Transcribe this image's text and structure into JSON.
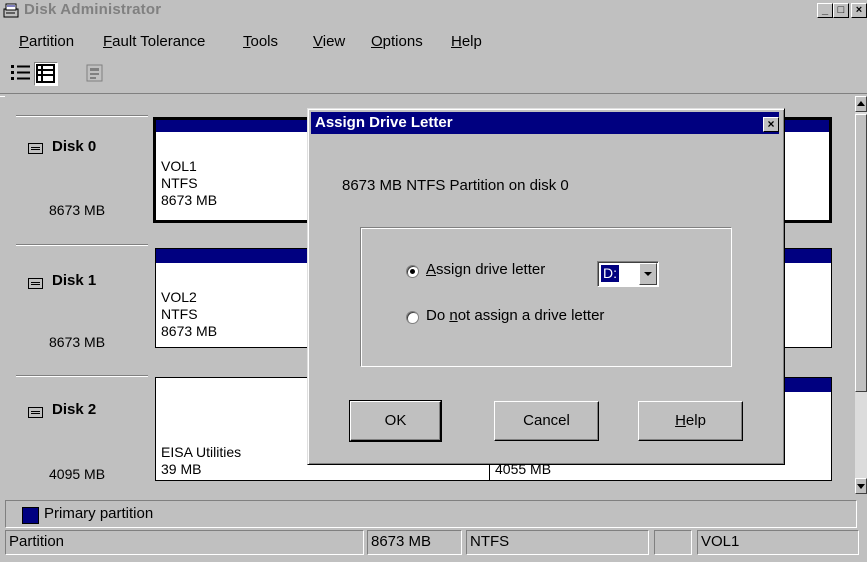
{
  "window": {
    "title": "Disk Administrator",
    "controls": {
      "minimize": "_",
      "maximize": "□",
      "close": "×"
    }
  },
  "menu": [
    {
      "label": "Partition",
      "accel": "P",
      "rest": "artition"
    },
    {
      "label": "Fault Tolerance",
      "accel": "F",
      "rest": "ault Tolerance"
    },
    {
      "label": "Tools",
      "accel": "T",
      "rest": "ools"
    },
    {
      "label": "View",
      "accel": "V",
      "rest": "iew"
    },
    {
      "label": "Options",
      "accel": "O",
      "rest": "ptions"
    },
    {
      "label": "Help",
      "accel": "H",
      "rest": "elp"
    }
  ],
  "toolbar": {
    "icons": [
      "volumes-view-icon",
      "disk-config-view-icon",
      "properties-icon"
    ]
  },
  "disks": [
    {
      "name": "Disk 0",
      "size": "8673 MB",
      "partitions": [
        {
          "line1": "VOL1",
          "line2": "NTFS",
          "line3": "8673 MB"
        }
      ]
    },
    {
      "name": "Disk 1",
      "size": "8673 MB",
      "partitions": [
        {
          "line1": "VOL2",
          "line2": "NTFS",
          "line3": "8673 MB"
        }
      ]
    },
    {
      "name": "Disk 2",
      "size": "4095 MB",
      "partitions": [
        {
          "line1": "EISA Utilities",
          "line2": "39 MB"
        },
        {
          "line1": "4055 MB"
        }
      ]
    }
  ],
  "legend": {
    "label": "Primary partition",
    "color": "#000080"
  },
  "status": {
    "type": "Partition",
    "size": "8673 MB",
    "filesystem": "NTFS",
    "drive": "",
    "volume": "VOL1"
  },
  "dialog": {
    "title": "Assign Drive Letter",
    "close": "×",
    "description": "8673 MB NTFS Partition on disk 0",
    "option_assign": {
      "pre": "",
      "accel": "A",
      "post": "ssign drive letter",
      "checked": true
    },
    "option_none": {
      "pre": "Do ",
      "accel": "n",
      "post": "ot assign a drive letter",
      "checked": false
    },
    "drive_letter": "D:",
    "buttons": {
      "ok": "OK",
      "cancel": "Cancel",
      "help_accel": "H",
      "help_rest": "elp"
    }
  },
  "colors": {
    "face": "#c0c0c0",
    "title_active": "#000080",
    "partition": "#000080"
  }
}
